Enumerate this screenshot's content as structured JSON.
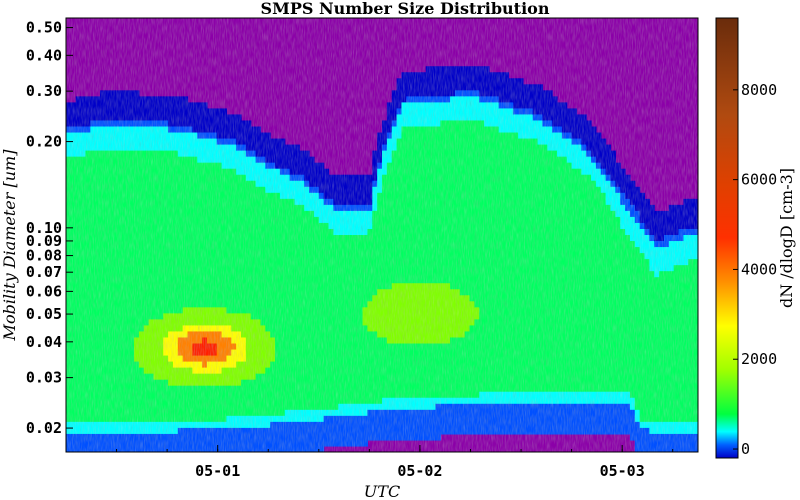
{
  "chart_data": {
    "type": "heatmap",
    "title": "SMPS Number Size Distribution",
    "xlabel": "UTC",
    "ylabel": "Mobility Diameter [um]",
    "y_scale": "log",
    "ylim": [
      0.0165,
      0.54
    ],
    "xlim": [
      "2023-04-30 06:00",
      "2023-05-03 09:00"
    ],
    "x_ticks": [
      {
        "value": "2023-05-01 00:00",
        "label": "05-01"
      },
      {
        "value": "2023-05-02 00:00",
        "label": "05-02"
      },
      {
        "value": "2023-05-03 00:00",
        "label": "05-03"
      }
    ],
    "y_ticks": [
      {
        "value": 0.5,
        "label": "0.50"
      },
      {
        "value": 0.4,
        "label": "0.40"
      },
      {
        "value": 0.3,
        "label": "0.30"
      },
      {
        "value": 0.2,
        "label": "0.20"
      },
      {
        "value": 0.1,
        "label": "0.10"
      },
      {
        "value": 0.09,
        "label": "0.09"
      },
      {
        "value": 0.08,
        "label": "0.08"
      },
      {
        "value": 0.07,
        "label": "0.07"
      },
      {
        "value": 0.06,
        "label": "0.06"
      },
      {
        "value": 0.05,
        "label": "0.05"
      },
      {
        "value": 0.04,
        "label": "0.04"
      },
      {
        "value": 0.03,
        "label": "0.03"
      },
      {
        "value": 0.02,
        "label": "0.02"
      }
    ],
    "colorbar": {
      "label": "dN /dlogD [cm-3]",
      "range": [
        -200,
        9600
      ],
      "ticks": [
        {
          "value": 0,
          "label": "0"
        },
        {
          "value": 2000,
          "label": "2000"
        },
        {
          "value": 4000,
          "label": "4000"
        },
        {
          "value": 6000,
          "label": "6000"
        },
        {
          "value": 8000,
          "label": "8000"
        }
      ],
      "colors": [
        "#0000c8",
        "#0050ff",
        "#00ffff",
        "#00ff60",
        "#80ff00",
        "#ffff00",
        "#ff8000",
        "#ff2000",
        "#c04000",
        "#6a2c0c"
      ]
    },
    "background_color": "#8b00a8",
    "mode_features": [
      {
        "center": "2023-04-30 22:30",
        "diameter_um": 0.038,
        "peak": 4500
      },
      {
        "center": "2023-05-02 00:00",
        "diameter_um": 0.05,
        "peak": 2600
      },
      {
        "center": "2023-05-01 16:00",
        "diameter_um": 0.09,
        "peak": 1200
      }
    ]
  }
}
